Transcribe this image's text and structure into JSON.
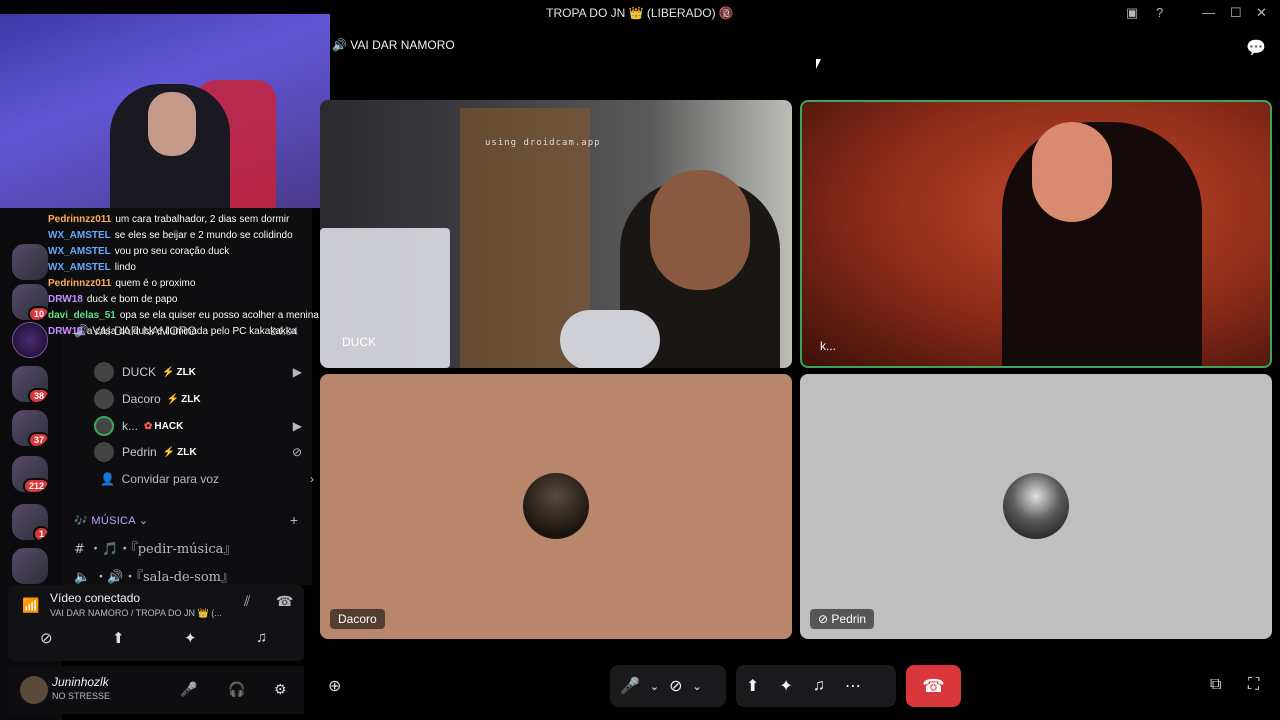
{
  "window": {
    "title": "TROPA DO JN 👑 (LIBERADO) 🔞",
    "icons": [
      "inbox-icon",
      "help-icon",
      "minimize-icon",
      "maximize-icon",
      "close-icon"
    ],
    "inbox": "▣",
    "help": "?",
    "min": "—",
    "max": "☐",
    "close": "✕"
  },
  "servers": [
    {
      "badge": "10"
    },
    {
      "badge": ""
    },
    {
      "badge": "38"
    },
    {
      "badge": "37"
    },
    {
      "badge": "212"
    },
    {
      "badge": "1"
    },
    {
      "badge": ""
    }
  ],
  "overlay_chat": [
    {
      "user": "Pedrinnzz011",
      "msg": "um cara trabalhador, 2 dias sem dormir",
      "color": "u-orange"
    },
    {
      "user": "WX_AMSTEL",
      "msg": "se eles se beijar e 2 mundo se colidindo",
      "color": "u-blue"
    },
    {
      "user": "WX_AMSTEL",
      "msg": "vou pro seu coração duck",
      "color": "u-blue"
    },
    {
      "user": "WX_AMSTEL",
      "msg": "lindo",
      "color": "u-blue"
    },
    {
      "user": "Pedrinnzz011",
      "msg": "quem é o proximo",
      "color": "u-orange"
    },
    {
      "user": "DRW18",
      "msg": "duck e bom de papo",
      "color": "u-purple"
    },
    {
      "user": "davi_delas_51",
      "msg": "opa se ela quiser eu posso acolher a menina lá",
      "color": "u-green"
    },
    {
      "user": "DRW18",
      "msg": "a casa do duck e iluminada pelo PC kakakakka",
      "color": "u-purple"
    }
  ],
  "channels": {
    "current_voice": {
      "name": "VAI DAR NAMORO",
      "time": "24:04"
    },
    "voice_users": [
      {
        "name": "DUCK",
        "tag": "ZLK",
        "tag_icon": "⚡",
        "icon": "▶"
      },
      {
        "name": "Dacoro",
        "tag": "ZLK",
        "tag_icon": "⚡",
        "icon": ""
      },
      {
        "name": "k...",
        "tag": "HACK",
        "tag_icon": "✿",
        "icon": "▶"
      },
      {
        "name": "Pedrin",
        "tag": "ZLK",
        "tag_icon": "⚡",
        "icon": "⊘"
      }
    ],
    "invite": "Convidar para voz",
    "category": "MÚSICA",
    "music_channels": [
      {
        "icon": "#",
        "name": "・🎵・『pedir-música』"
      },
      {
        "icon": "🔈",
        "name": "・🔊・『sala-de-som』"
      }
    ]
  },
  "voice_connection": {
    "status": "Vídeo conectado",
    "sub": "VAI DAR NAMORO / TROPA DO JN 👑 (..."
  },
  "user_panel": {
    "name": "Juninhozlk",
    "status": "NO STRESSE"
  },
  "call": {
    "title": "VAI DAR NAMORO",
    "tiles": [
      {
        "name": "DUCK",
        "watermark": "using droidcam.app"
      },
      {
        "name": "k..."
      },
      {
        "name": "Dacoro"
      },
      {
        "name": "Pedrin"
      }
    ]
  },
  "controls": {
    "mic": "🎤",
    "camera": "⊘",
    "share": "⬆",
    "activity": "✦",
    "soundboard": "♫",
    "more": "⋯",
    "hangup": "☎",
    "popout": "⧉",
    "fullscreen": "⛶",
    "add_user": "⊕"
  }
}
